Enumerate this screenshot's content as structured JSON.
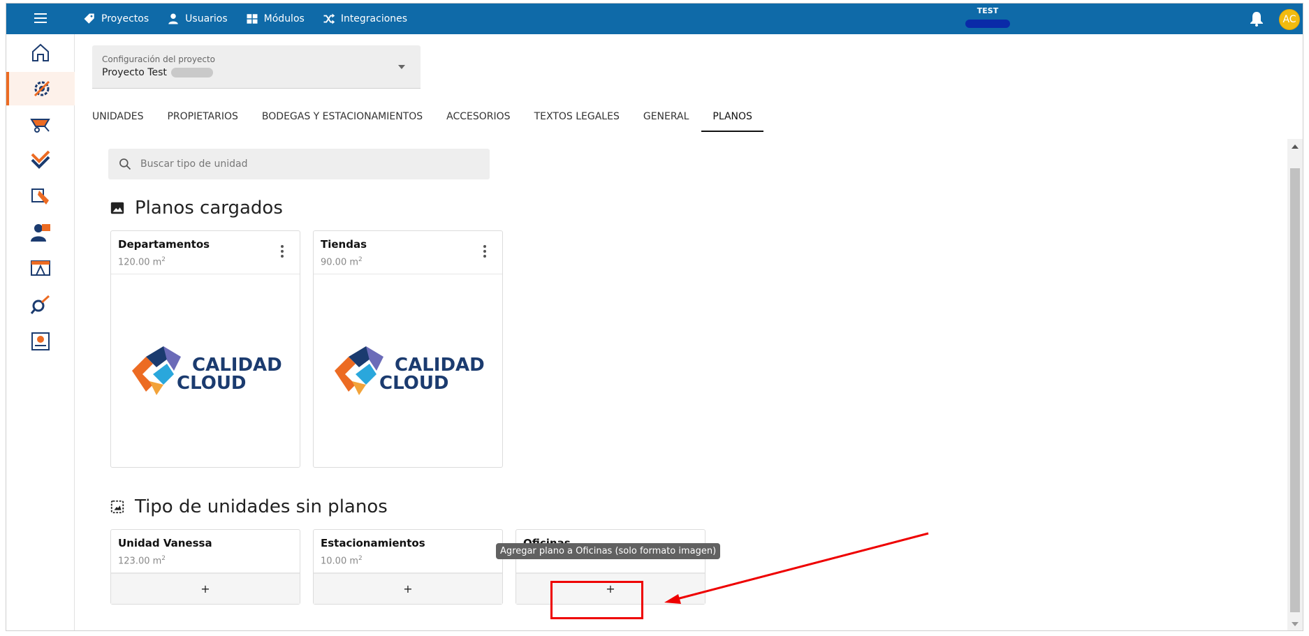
{
  "topbar": {
    "nav": [
      {
        "label": "Proyectos",
        "icon": "tag-icon"
      },
      {
        "label": "Usuarios",
        "icon": "user-icon"
      },
      {
        "label": "Módulos",
        "icon": "grid-icon"
      },
      {
        "label": "Integraciones",
        "icon": "shuffle-icon"
      }
    ],
    "environment": "TEST",
    "avatar_initials": "AC"
  },
  "project_select": {
    "label": "Configuración del proyecto",
    "value": "Proyecto Test"
  },
  "tabs": [
    {
      "label": "UNIDADES"
    },
    {
      "label": "PROPIETARIOS"
    },
    {
      "label": "BODEGAS Y ESTACIONAMIENTOS"
    },
    {
      "label": "ACCESORIOS"
    },
    {
      "label": "TEXTOS LEGALES"
    },
    {
      "label": "GENERAL"
    },
    {
      "label": "PLANOS",
      "active": true
    }
  ],
  "search": {
    "placeholder": "Buscar tipo de unidad"
  },
  "uploaded": {
    "title": "Planos cargados",
    "cards": [
      {
        "name": "Departamentos",
        "area": "120.00 m",
        "logo_line1": "CALIDAD",
        "logo_line2": "CLOUD"
      },
      {
        "name": "Tiendas",
        "area": "90.00 m",
        "logo_line1": "CALIDAD",
        "logo_line2": "CLOUD"
      }
    ]
  },
  "missing": {
    "title": "Tipo de unidades sin planos",
    "cards": [
      {
        "name": "Unidad Vanessa",
        "area": "123.00 m",
        "add": "+"
      },
      {
        "name": "Estacionamientos",
        "area": "10.00 m",
        "add": "+"
      },
      {
        "name": "Oficinas",
        "area": "",
        "add": "+"
      }
    ]
  },
  "tooltip": "Agregar plano a Oficinas (solo formato imagen)",
  "area_unit_exponent": "2",
  "colors": {
    "topbar": "#0f6aa8",
    "accent": "#ec6b23",
    "annotation": "#ee0000"
  }
}
